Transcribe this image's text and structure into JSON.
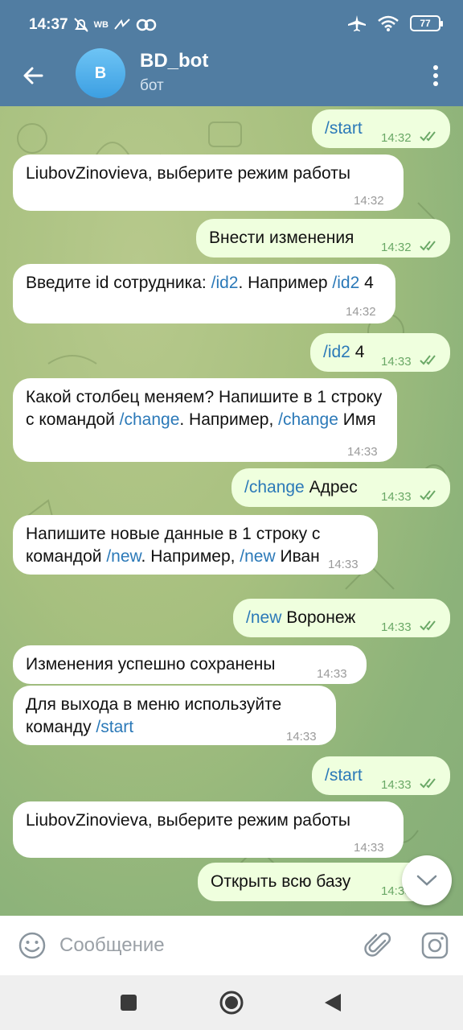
{
  "status_bar": {
    "time": "14:37",
    "carrier_badge": "WB",
    "battery_level": "77"
  },
  "header": {
    "title": "BD_bot",
    "subtitle": "бот",
    "avatar_letter": "B"
  },
  "messages": [
    {
      "dir": "out",
      "parts": [
        {
          "t": "/start",
          "link": true
        }
      ],
      "time": "14:32",
      "read": true
    },
    {
      "dir": "in",
      "parts": [
        {
          "t": "LiubovZinovieva, выберите режим работы",
          "link": false
        }
      ],
      "time": "14:32"
    },
    {
      "dir": "out",
      "parts": [
        {
          "t": "Внести изменения",
          "link": false
        }
      ],
      "time": "14:32",
      "read": true
    },
    {
      "dir": "in",
      "parts": [
        {
          "t": "Введите id сотрудника: ",
          "link": false
        },
        {
          "t": "/id2",
          "link": true
        },
        {
          "t": ". Например ",
          "link": false
        },
        {
          "t": "/id2",
          "link": true
        },
        {
          "t": " 4",
          "link": false
        }
      ],
      "time": "14:32"
    },
    {
      "dir": "out",
      "parts": [
        {
          "t": "/id2",
          "link": true
        },
        {
          "t": " 4",
          "link": false
        }
      ],
      "time": "14:33",
      "read": true
    },
    {
      "dir": "in",
      "parts": [
        {
          "t": "Какой столбец меняем? Напишите в 1 строку с командой ",
          "link": false
        },
        {
          "t": "/change",
          "link": true
        },
        {
          "t": ". Например, ",
          "link": false
        },
        {
          "t": "/change",
          "link": true
        },
        {
          "t": " Имя",
          "link": false
        }
      ],
      "time": "14:33"
    },
    {
      "dir": "out",
      "parts": [
        {
          "t": "/change",
          "link": true
        },
        {
          "t": " Адрес",
          "link": false
        }
      ],
      "time": "14:33",
      "read": true
    },
    {
      "dir": "in",
      "parts": [
        {
          "t": "Напишите новые данные в 1 строку с командой ",
          "link": false
        },
        {
          "t": "/new",
          "link": true
        },
        {
          "t": ". Например, ",
          "link": false
        },
        {
          "t": "/new",
          "link": true
        },
        {
          "t": " Иван",
          "link": false
        }
      ],
      "time": "14:33"
    },
    {
      "dir": "out",
      "parts": [
        {
          "t": "/new",
          "link": true
        },
        {
          "t": " Воронеж",
          "link": false
        }
      ],
      "time": "14:33",
      "read": true
    },
    {
      "dir": "in",
      "parts": [
        {
          "t": "Изменения успешно сохранены",
          "link": false
        }
      ],
      "time": "14:33"
    },
    {
      "dir": "in",
      "parts": [
        {
          "t": "Для выхода в меню используйте команду ",
          "link": false
        },
        {
          "t": "/start",
          "link": true
        }
      ],
      "time": "14:33"
    },
    {
      "dir": "out",
      "parts": [
        {
          "t": "/start",
          "link": true
        }
      ],
      "time": "14:33",
      "read": true
    },
    {
      "dir": "in",
      "parts": [
        {
          "t": "LiubovZinovieva, выберите режим работы",
          "link": false
        }
      ],
      "time": "14:33"
    },
    {
      "dir": "out",
      "parts": [
        {
          "t": "Открыть всю базу",
          "link": false
        }
      ],
      "time": "14:33",
      "read": true
    }
  ],
  "input": {
    "placeholder": "Сообщение"
  },
  "colors": {
    "header": "#517da2",
    "incoming_bubble": "#ffffff",
    "outgoing_bubble": "#efffde",
    "link": "#2b79b8",
    "read_check": "#6aa866"
  },
  "icons": [
    "bell-off-icon",
    "wifi-icon",
    "airplane-icon",
    "battery-icon",
    "back-arrow-icon",
    "more-vert-icon",
    "emoji-icon",
    "attach-icon",
    "camera-icon",
    "chevron-down-icon",
    "nav-recents-icon",
    "nav-home-icon",
    "nav-back-icon"
  ]
}
